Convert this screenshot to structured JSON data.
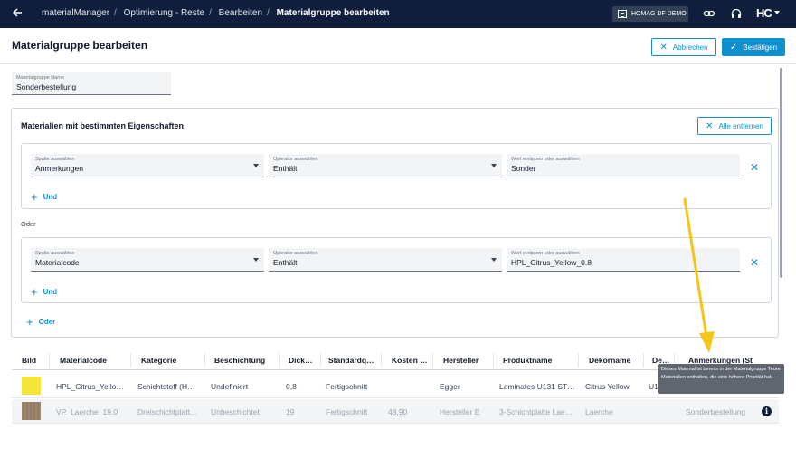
{
  "breadcrumb": [
    "materialManager",
    "Optimierung - Reste",
    "Bearbeiten",
    "Materialgruppe bearbeiten"
  ],
  "tenant": "HOMAG DF DEMO",
  "brand": "HC",
  "page": {
    "title": "Materialgruppe bearbeiten",
    "cancel_label": "Abbrechen",
    "confirm_label": "Bestätigen"
  },
  "group_name": {
    "label": "Materialgruppe Name",
    "value": "Sonderbestellung"
  },
  "filter_panel": {
    "title": "Materialien mit bestimmten Eigenschaften",
    "clear_label": "Alle entfernen",
    "or_label": "Oder",
    "and_label": "Und",
    "add_or_label": "Oder",
    "conditions": [
      {
        "column_label": "Spalte auswählen",
        "column_value": "Anmerkungen",
        "operator_label": "Operator auswählen",
        "operator_value": "Enthält",
        "value_label": "Wert eintippen oder auswählen",
        "value_value": "Sonder"
      },
      {
        "column_label": "Spalte auswählen",
        "column_value": "Materialcode",
        "operator_label": "Operator auswählen",
        "operator_value": "Enthält",
        "value_label": "Wert eintippen oder auswählen",
        "value_value": "HPL_Citrus_Yellow_0.8"
      }
    ]
  },
  "table": {
    "headers": [
      "Bild",
      "Materialcode",
      "Kategorie",
      "Beschichtung",
      "Dick…",
      "Standardq…",
      "Kosten …",
      "Hersteller",
      "Produktname",
      "Dekorname",
      "De…",
      "Anmerkungen (St"
    ],
    "rows": [
      {
        "materialcode": "HPL_Citrus_Yello…",
        "kategorie": "Schichtstoff (H…",
        "beschichtung": "Undefiniert",
        "dicke": "0,8",
        "standard": "Fertigschnitt",
        "kosten": "",
        "hersteller": "Egger",
        "produktname": "Laminates U131 ST…",
        "dekorname": "Citrus Yellow",
        "de": "U1",
        "anmerkungen": "",
        "swatch_color": "#f5e63a"
      },
      {
        "materialcode": "VP_Laerche_19.0",
        "kategorie": "Dreischichtplatt…",
        "beschichtung": "Unbeschichtet",
        "dicke": "19",
        "standard": "Fertigschnitt",
        "kosten": "48,90",
        "hersteller": "Hersteller E",
        "produktname": "3-Schichtplatte Lae…",
        "dekorname": "Laerche",
        "de": "",
        "anmerkungen": "Sonderbestellung",
        "swatch_color": "#a58c74"
      }
    ]
  },
  "tooltip": "Dieses Material ist bereits in der Materialgruppe Teure Materialien enthalten, die eine höhere Priorität hat.",
  "colors": {
    "accent": "#0e8fd0",
    "topbar": "#0f1e3d",
    "annotation_arrow": "#f5c518"
  }
}
